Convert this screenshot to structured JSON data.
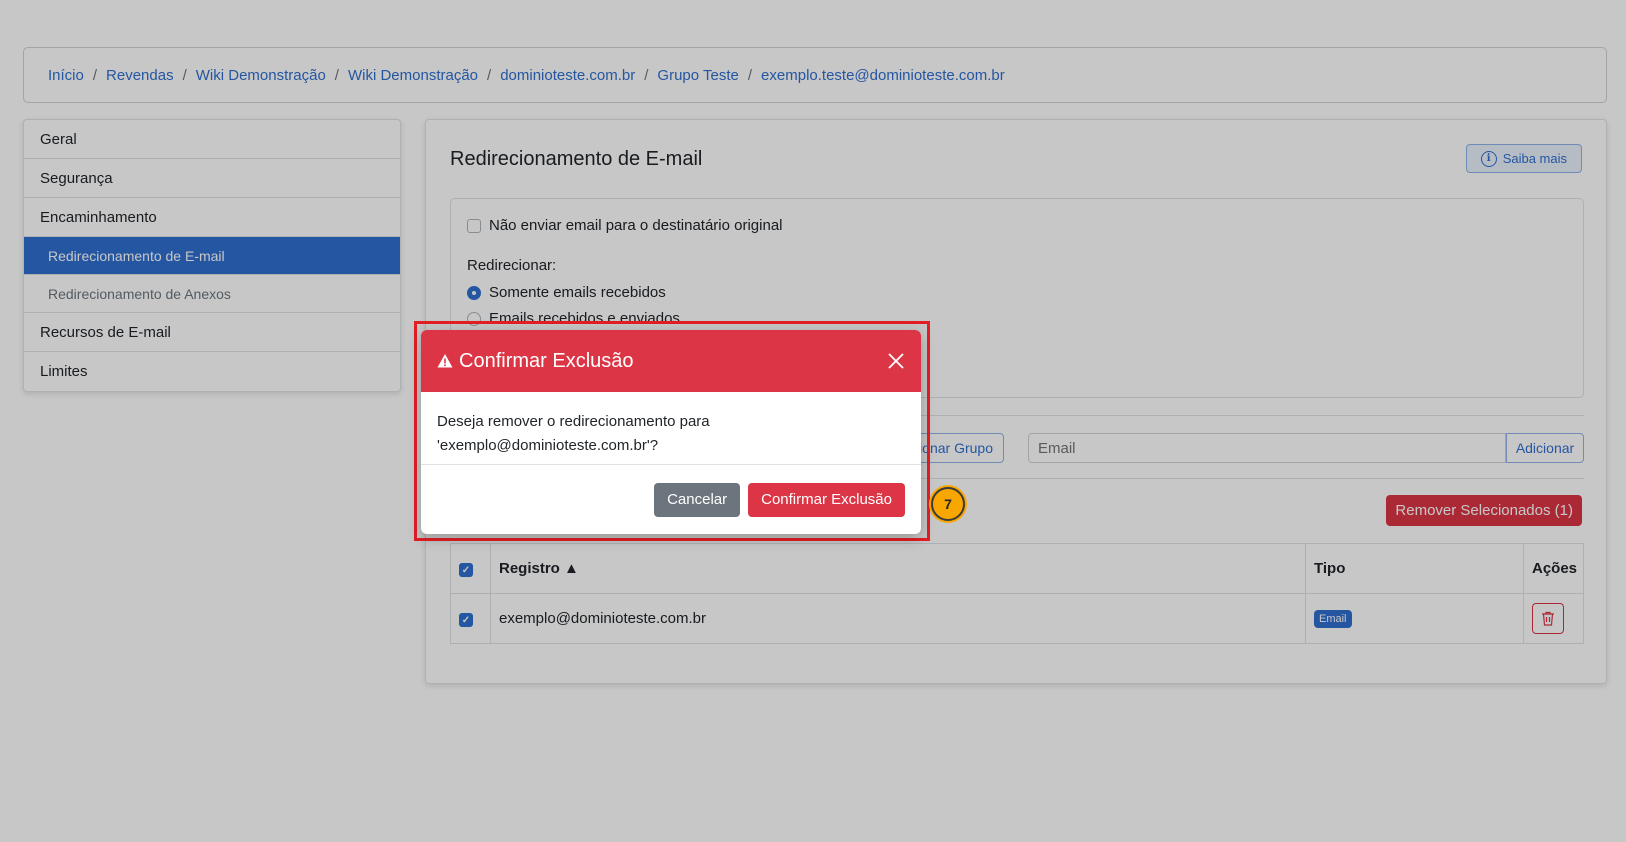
{
  "breadcrumb": {
    "items": [
      "Início",
      "Revendas",
      "Wiki Demonstração",
      "Wiki Demonstração",
      "dominioteste.com.br",
      "Grupo Teste",
      "exemplo.teste@dominioteste.com.br"
    ],
    "separator": "/"
  },
  "sidebar": {
    "items": [
      {
        "label": "Geral"
      },
      {
        "label": "Segurança"
      },
      {
        "label": "Encaminhamento"
      },
      {
        "label": "Redirecionamento de E-mail",
        "active": true
      },
      {
        "label": "Redirecionamento de Anexos"
      },
      {
        "label": "Recursos de E-mail"
      },
      {
        "label": "Limites"
      }
    ]
  },
  "main": {
    "title": "Redirecionamento de E-mail",
    "saiba_mais": "Saiba mais",
    "no_send_original": "Não enviar email para o destinatário original",
    "redirect_label": "Redirecionar:",
    "radio_options": [
      "Somente emails recebidos",
      "Emails recebidos e enviados"
    ],
    "group_button": "ionar Grupo",
    "email_placeholder": "Email",
    "add_button": "Adicionar",
    "remove_selected": "Remover Selecionados (1)",
    "table": {
      "headers": [
        "Registro ▲",
        "Tipo",
        "Ações"
      ],
      "rows": [
        {
          "registro": "exemplo@dominioteste.com.br",
          "tipo": "Email"
        }
      ]
    }
  },
  "modal": {
    "title": "Confirmar Exclusão",
    "body_line1": "Deseja remover o redirecionamento para",
    "body_line2": "'exemplo@dominioteste.com.br'?",
    "cancel": "Cancelar",
    "confirm": "Confirmar Exclusão"
  },
  "step_badge": "7",
  "colors": {
    "primary": "#2f6fd0",
    "danger": "#dc3545",
    "secondary": "#6c757d",
    "highlight": "#e31e24",
    "badge": "#f8a700"
  }
}
